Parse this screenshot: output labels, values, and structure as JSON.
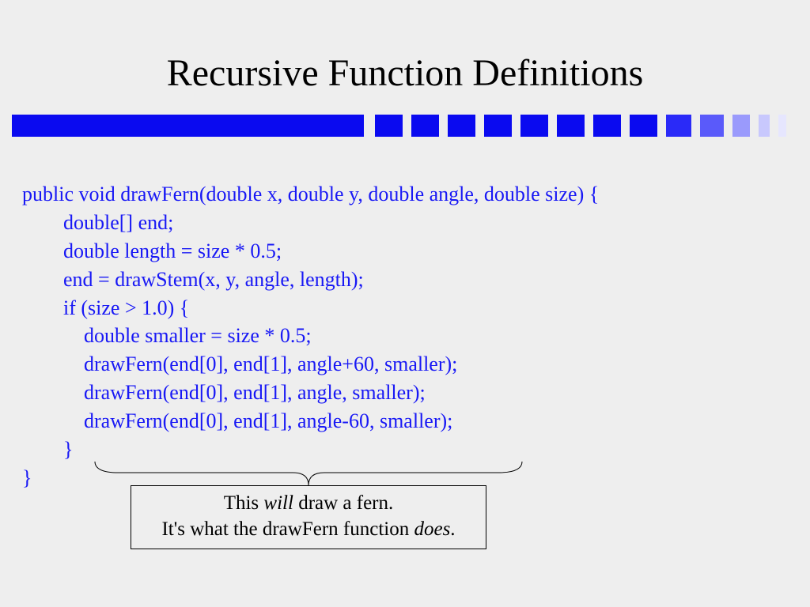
{
  "title": "Recursive Function Definitions",
  "code": {
    "sig": "public void drawFern(double x, double y, double angle, double size) {",
    "l1": "        double[] end;",
    "l2": "        double length = size * 0.5;",
    "l3": "        end = drawStem(x, y, angle, length);",
    "l4": "        if (size > 1.0) {",
    "l5": "            double smaller = size * 0.5;",
    "l6": "            drawFern(end[0], end[1], angle+60, smaller);",
    "l7": "            drawFern(end[0], end[1], angle, smaller);",
    "l8": "            drawFern(end[0], end[1], angle-60, smaller);",
    "l9": "        }",
    "l10": "}"
  },
  "callout": {
    "line1_pre": "This ",
    "line1_will": "will",
    "line1_post": " draw a fern.",
    "line2_pre": "It's what the drawFern function ",
    "line2_does": "does",
    "line2_post": "."
  },
  "colors": {
    "bars": [
      "#0a0af0",
      "#0a0af0",
      "#0a0af0",
      "#0a0af0",
      "#0a0af0",
      "#0a0af0",
      "#0a0af0",
      "#0a0af0",
      "#2a2af8",
      "#5a5afa",
      "#9a9afc",
      "#c8c8fd",
      "#e6e6fe"
    ],
    "widths": [
      35,
      35,
      35,
      35,
      35,
      35,
      35,
      35,
      32,
      30,
      22,
      14,
      10
    ]
  }
}
